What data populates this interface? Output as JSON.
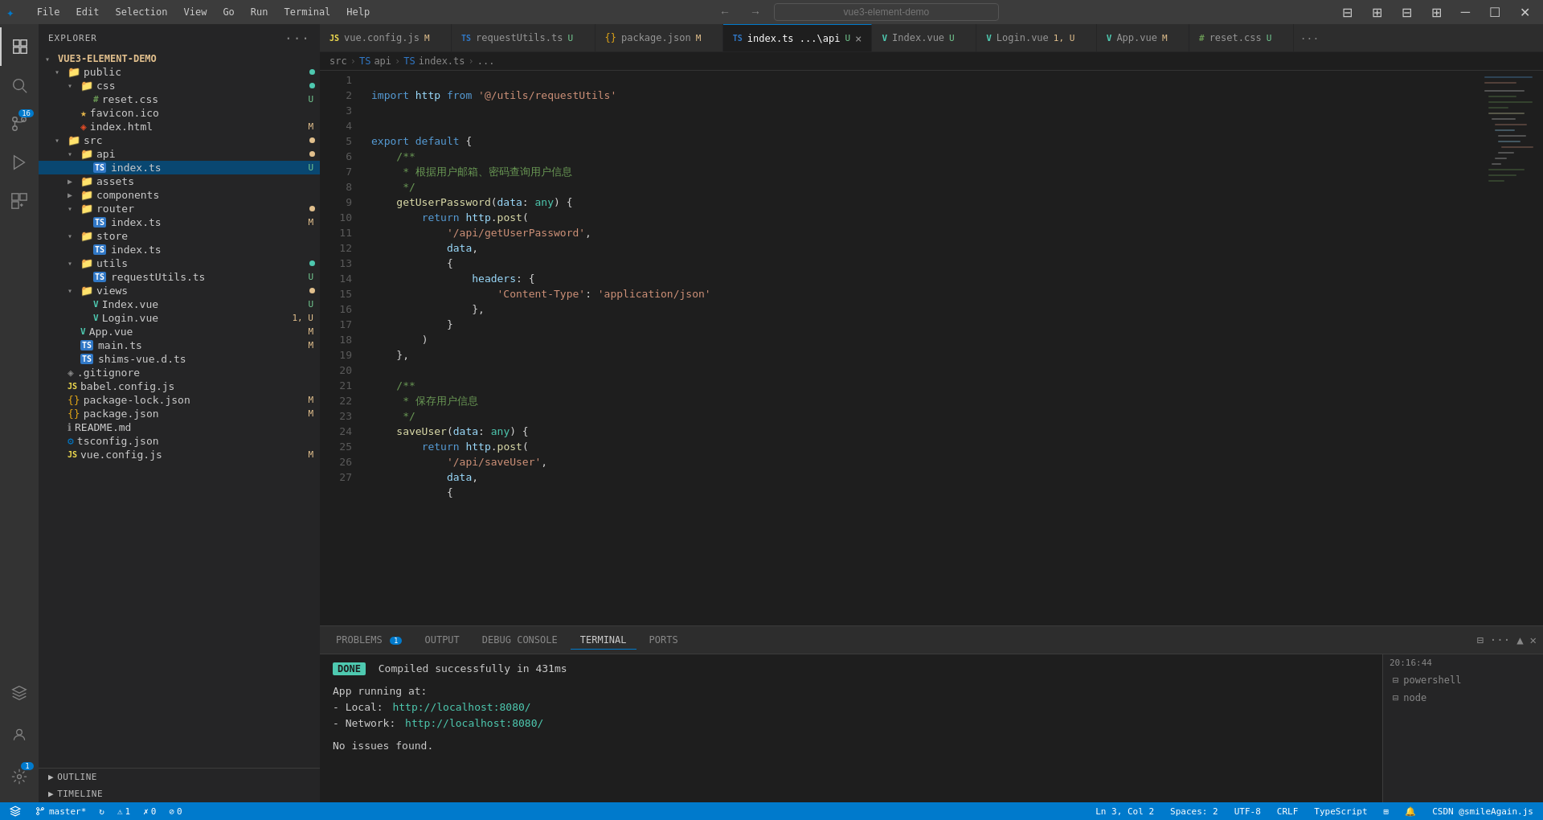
{
  "titlebar": {
    "app_icon": "⬛",
    "menu_items": [
      "File",
      "Edit",
      "Selection",
      "View",
      "Go",
      "Run",
      "Terminal",
      "Help"
    ],
    "search_placeholder": "vue3-element-demo",
    "window_controls": [
      "⊟",
      "☐",
      "✕"
    ],
    "back_icon": "←",
    "forward_icon": "→"
  },
  "activitybar": {
    "icons": [
      {
        "name": "explorer-icon",
        "symbol": "⬛",
        "active": true
      },
      {
        "name": "search-icon",
        "symbol": "🔍",
        "active": false
      },
      {
        "name": "source-control-icon",
        "symbol": "⑂",
        "active": false,
        "badge": "16"
      },
      {
        "name": "run-debug-icon",
        "symbol": "▷",
        "active": false
      },
      {
        "name": "extensions-icon",
        "symbol": "⊞",
        "active": false
      }
    ],
    "bottom_icons": [
      {
        "name": "remote-icon",
        "symbol": "⊙"
      },
      {
        "name": "account-icon",
        "symbol": "👤"
      },
      {
        "name": "settings-icon",
        "symbol": "⚙",
        "badge": "1"
      }
    ]
  },
  "sidebar": {
    "title": "EXPLORER",
    "more_icon": "···",
    "project_name": "VUE3-ELEMENT-DEMO",
    "tree": [
      {
        "level": 0,
        "type": "folder",
        "name": "public",
        "expanded": true,
        "dot": "green"
      },
      {
        "level": 1,
        "type": "folder",
        "name": "css",
        "expanded": true,
        "dot": "green"
      },
      {
        "level": 2,
        "type": "file",
        "name": "reset.css",
        "icon": "#",
        "badge": "U",
        "badge_type": "u"
      },
      {
        "level": 1,
        "type": "file",
        "name": "favicon.ico",
        "icon": "★"
      },
      {
        "level": 1,
        "type": "file",
        "name": "index.html",
        "icon": "◈",
        "badge": "M",
        "badge_type": "m"
      },
      {
        "level": 0,
        "type": "folder",
        "name": "src",
        "expanded": true,
        "dot": "orange"
      },
      {
        "level": 1,
        "type": "folder",
        "name": "api",
        "expanded": true,
        "dot": "orange"
      },
      {
        "level": 2,
        "type": "file",
        "name": "index.ts",
        "icon": "TS",
        "badge": "U",
        "badge_type": "u",
        "selected": true
      },
      {
        "level": 1,
        "type": "folder",
        "name": "assets",
        "expanded": false
      },
      {
        "level": 1,
        "type": "folder",
        "name": "components",
        "expanded": false
      },
      {
        "level": 1,
        "type": "folder",
        "name": "router",
        "expanded": false,
        "dot": "orange"
      },
      {
        "level": 2,
        "type": "file",
        "name": "index.ts",
        "icon": "TS",
        "badge": "M",
        "badge_type": "m"
      },
      {
        "level": 1,
        "type": "folder",
        "name": "store",
        "expanded": true
      },
      {
        "level": 2,
        "type": "file",
        "name": "index.ts",
        "icon": "TS"
      },
      {
        "level": 1,
        "type": "folder",
        "name": "utils",
        "expanded": true,
        "dot": "green"
      },
      {
        "level": 2,
        "type": "file",
        "name": "requestUtils.ts",
        "icon": "TS",
        "badge": "U",
        "badge_type": "u"
      },
      {
        "level": 1,
        "type": "folder",
        "name": "views",
        "expanded": true,
        "dot": "orange"
      },
      {
        "level": 2,
        "type": "file",
        "name": "Index.vue",
        "icon": "V",
        "badge": "U",
        "badge_type": "u"
      },
      {
        "level": 2,
        "type": "file",
        "name": "Login.vue",
        "icon": "V",
        "badge": "1, U",
        "badge_type": "mixed"
      },
      {
        "level": 1,
        "type": "file",
        "name": "App.vue",
        "icon": "V",
        "badge": "M",
        "badge_type": "m"
      },
      {
        "level": 1,
        "type": "file",
        "name": "main.ts",
        "icon": "TS",
        "badge": "M",
        "badge_type": "m"
      },
      {
        "level": 1,
        "type": "file",
        "name": "shims-vue.d.ts",
        "icon": "TS"
      },
      {
        "level": 0,
        "type": "file",
        "name": ".gitignore",
        "icon": "◈"
      },
      {
        "level": 0,
        "type": "file",
        "name": "babel.config.js",
        "icon": "JS"
      },
      {
        "level": 0,
        "type": "file",
        "name": "package-lock.json",
        "icon": "{}",
        "badge": "M",
        "badge_type": "m"
      },
      {
        "level": 0,
        "type": "file",
        "name": "package.json",
        "icon": "{}",
        "badge": "M",
        "badge_type": "m"
      },
      {
        "level": 0,
        "type": "file",
        "name": "README.md",
        "icon": "ℹ"
      },
      {
        "level": 0,
        "type": "file",
        "name": "tsconfig.json",
        "icon": "⚙"
      },
      {
        "level": 0,
        "type": "file",
        "name": "vue.config.js",
        "icon": "JS",
        "badge": "M",
        "badge_type": "m"
      }
    ],
    "outline_label": "OUTLINE",
    "timeline_label": "TIMELINE"
  },
  "tabs": [
    {
      "label": "vue.config.js",
      "type": "js",
      "badge": "M",
      "badge_type": "m",
      "active": false
    },
    {
      "label": "requestUtils.ts",
      "type": "ts",
      "badge": "U",
      "badge_type": "u",
      "active": false
    },
    {
      "label": "package.json",
      "type": "json",
      "badge": "M",
      "badge_type": "m",
      "active": false
    },
    {
      "label": "index.ts ...\\api",
      "type": "ts",
      "badge": "U",
      "badge_type": "u",
      "active": true
    },
    {
      "label": "Index.vue",
      "type": "vue",
      "badge": "U",
      "badge_type": "u",
      "active": false
    },
    {
      "label": "Login.vue",
      "type": "vue",
      "badge": "1, U",
      "badge_type": "mixed",
      "active": false
    },
    {
      "label": "App.vue",
      "type": "vue",
      "badge": "M",
      "badge_type": "m",
      "active": false
    },
    {
      "label": "reset.css",
      "type": "css",
      "badge": "U",
      "badge_type": "u",
      "active": false
    }
  ],
  "breadcrumb": {
    "parts": [
      "src",
      "api",
      "index.ts",
      "..."
    ]
  },
  "code": {
    "language": "typescript",
    "lines": [
      {
        "num": 1,
        "content": "import http from '@/utils/requestUtils'"
      },
      {
        "num": 2,
        "content": ""
      },
      {
        "num": 3,
        "content": ""
      },
      {
        "num": 4,
        "content": "export default {"
      },
      {
        "num": 5,
        "content": "    /**"
      },
      {
        "num": 6,
        "content": "     * 根据用户邮箱、密码查询用户信息"
      },
      {
        "num": 7,
        "content": "     */"
      },
      {
        "num": 8,
        "content": "    getUserPassword(data: any) {"
      },
      {
        "num": 9,
        "content": "        return http.post("
      },
      {
        "num": 10,
        "content": "            '/api/getUserPassword',"
      },
      {
        "num": 11,
        "content": "            data,"
      },
      {
        "num": 12,
        "content": "            {"
      },
      {
        "num": 13,
        "content": "                headers: {"
      },
      {
        "num": 14,
        "content": "                    'Content-Type': 'application/json'"
      },
      {
        "num": 15,
        "content": "                },"
      },
      {
        "num": 16,
        "content": "            }"
      },
      {
        "num": 17,
        "content": "        )"
      },
      {
        "num": 18,
        "content": "    },"
      },
      {
        "num": 19,
        "content": ""
      },
      {
        "num": 20,
        "content": "    /**"
      },
      {
        "num": 21,
        "content": "     * 保存用户信息"
      },
      {
        "num": 22,
        "content": "     */"
      },
      {
        "num": 23,
        "content": "    saveUser(data: any) {"
      },
      {
        "num": 24,
        "content": "        return http.post("
      },
      {
        "num": 25,
        "content": "            '/api/saveUser',"
      },
      {
        "num": 26,
        "content": "            data,"
      },
      {
        "num": 27,
        "content": "            {"
      }
    ]
  },
  "terminal": {
    "tabs": [
      {
        "label": "PROBLEMS",
        "badge": "1",
        "active": false
      },
      {
        "label": "OUTPUT",
        "active": false
      },
      {
        "label": "DEBUG CONSOLE",
        "active": false
      },
      {
        "label": "TERMINAL",
        "active": true
      },
      {
        "label": "PORTS",
        "active": false
      }
    ],
    "toolbar": {
      "split_icon": "⊟",
      "more_icon": "···",
      "maximize_icon": "▲",
      "close_icon": "✕"
    },
    "done_label": "DONE",
    "compile_msg": "Compiled successfully in 431ms",
    "app_running": "App running at:",
    "local_label": "- Local:",
    "local_url": "http://localhost:8080/",
    "network_label": "- Network:",
    "network_url": "http://localhost:8080/",
    "no_issues": "No issues found.",
    "timestamp": "20:16:44",
    "side_items": [
      "powershell",
      "node"
    ]
  },
  "statusbar": {
    "git_branch": "master*",
    "sync_icon": "↻",
    "warnings": "⚠ 1",
    "errors": "✗ 0",
    "lint": "⊘ 0",
    "position": "Ln 3, Col 2",
    "spaces": "Spaces: 2",
    "encoding": "UTF-8",
    "line_ending": "CRLF",
    "language": "TypeScript",
    "feedback": "CSDN @smileAgain.js",
    "notification_icon": "🔔",
    "layout_icon": "⊞"
  }
}
